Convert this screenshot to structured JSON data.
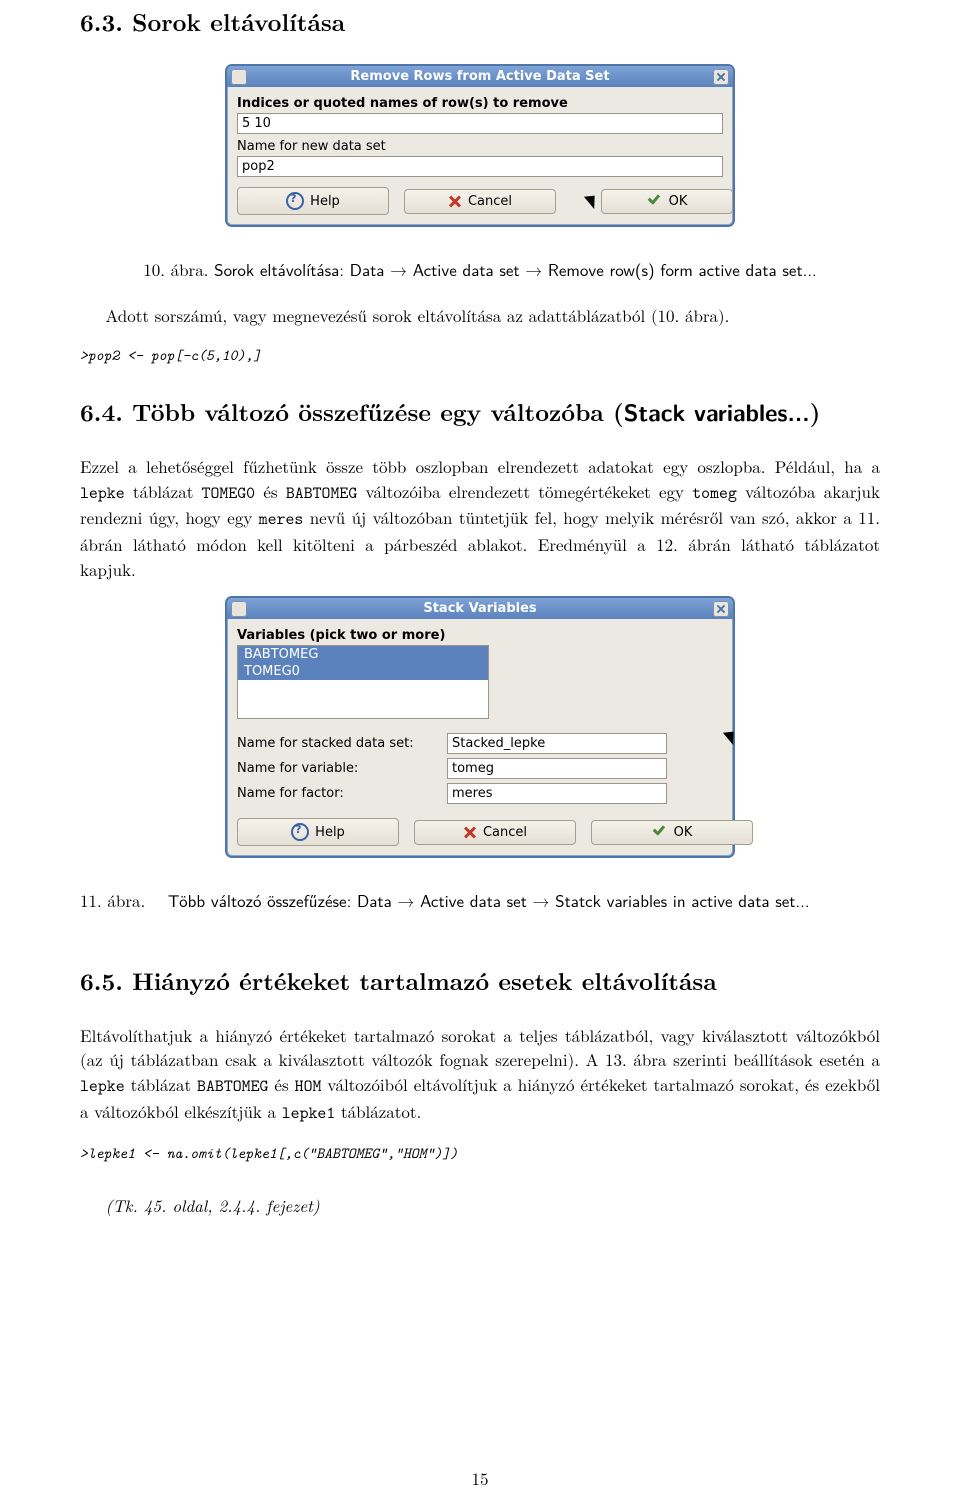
{
  "section63": {
    "heading": "6.3. Sorok eltávolítása"
  },
  "dialog1": {
    "title": "Remove Rows from Active Data Set",
    "label_indices": "Indices or quoted names of row(s) to remove",
    "value_indices": "5 10",
    "label_newname": "Name for new data set",
    "value_newname": "pop2",
    "btn_help": "Help",
    "btn_cancel": "Cancel",
    "btn_ok": "OK"
  },
  "caption10": {
    "prefix": "10. ábra.",
    "rest_sans": "Sorok eltávolítása: Data → Active data set → Remove row(s) form active data set..."
  },
  "para1": "Adott sorszámú, vagy megnevezésű sorok eltávolítása az adattáblázatból (10. ábra).",
  "code1": ">pop2 <- pop[-c(5,10),]",
  "section64": {
    "heading_prefix": "6.4. Több változó összefűzése egy változóba (",
    "heading_sans": "Stack variables...",
    "heading_suffix": ")"
  },
  "para64a": "Ezzel a lehetőséggel fűzhetünk össze több oszlopban elrendezett adatokat egy oszlopba. Például, ha a ",
  "tt_lepke": "lepke",
  "para64b": " táblázat ",
  "tt_TOMEG0": "TOMEG0",
  "para64c": " és ",
  "tt_BABTOMEG": "BABTOMEG",
  "para64d": " változóiba elrendezett tömegértékeket egy ",
  "tt_tomeg": "tomeg",
  "para64e": " változóba akarjuk rendezni úgy, hogy egy ",
  "tt_meres": "meres",
  "para64f": " nevű új változóban tüntetjük fel, hogy melyik mérésről van szó, akkor a 11. ábrán látható módon kell kitölteni a párbeszéd ablakot. Eredményül a 12. ábrán látható táblázatot kapjuk.",
  "dialog2": {
    "title": "Stack Variables",
    "label_vars": "Variables (pick two or more)",
    "list_items": [
      "BABTOMEG",
      "TOMEG0"
    ],
    "label_stacked": "Name for stacked data set:",
    "value_stacked": "Stacked_lepke",
    "label_variable": "Name for variable:",
    "value_variable": "tomeg",
    "label_factor": "Name for factor:",
    "value_factor": "meres",
    "btn_help": "Help",
    "btn_cancel": "Cancel",
    "btn_ok": "OK"
  },
  "caption11": {
    "prefix": "11. ábra.",
    "rest_sans_a": "Több változó összefűzése: Data → Active data set → Statck variables in active data set..."
  },
  "section65": {
    "heading": "6.5. Hiányzó értékeket tartalmazó esetek eltávolítása"
  },
  "para65a": "Eltávolíthatjuk a hiányzó értékeket tartalmazó sorokat a teljes táblázatból, vagy kiválasztott változókból (az új táblázatban csak a kiválasztott változók fognak szerepelni). A 13. ábra szerinti beállítások esetén a ",
  "tt_lepke2": "lepke",
  "para65b": " táblázat ",
  "tt_BABTOMEG2": "BABTOMEG",
  "para65c": " és ",
  "tt_HOM": "HOM",
  "para65d": " változóiból eltávolítjuk a hiányzó értékeket tartalmazó sorokat, és ezekből a változókból elkészítjük a ",
  "tt_lepke1": "lepke1",
  "para65e": " táblázatot.",
  "code2": ">lepke1 <- na.omit(lepke1[,c(\"BABTOMEG\",\"HOM\")])",
  "ref": "(Tk. 45. oldal, 2.4.4. fejezet)",
  "pagenum": "15"
}
